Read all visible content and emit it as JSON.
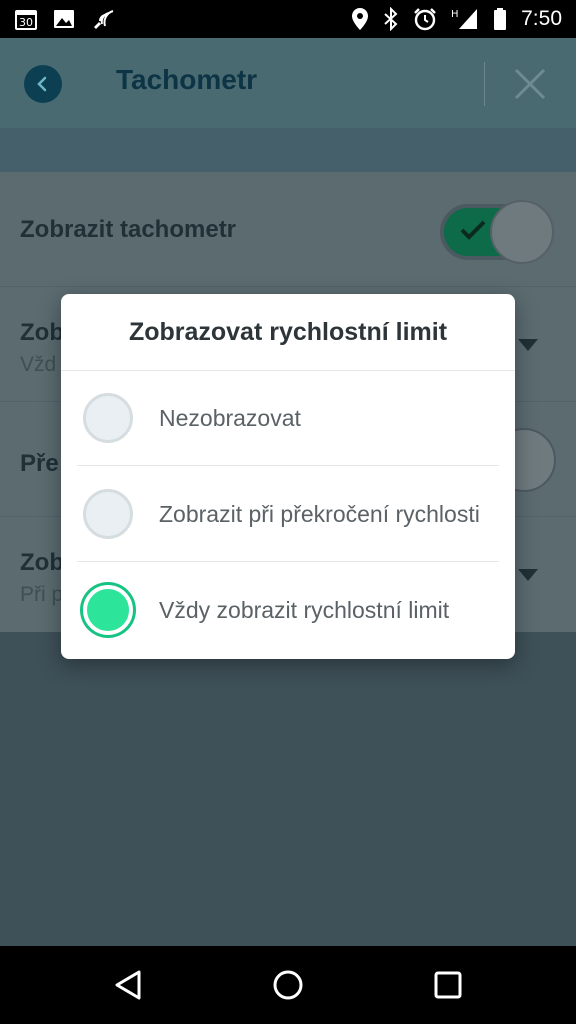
{
  "status_bar": {
    "calendar_day": "30",
    "network_type": "H",
    "time": "7:50",
    "icons_left": [
      "calendar-icon",
      "image-icon",
      "wifi-calling-icon"
    ],
    "icons_right": [
      "location-icon",
      "bluetooth-icon",
      "alarm-icon",
      "signal-icon",
      "battery-icon"
    ]
  },
  "app_bar": {
    "title": "Tachometr"
  },
  "settings": {
    "rows": [
      {
        "label": "Zobrazit tachometr",
        "sub": "",
        "control": "toggle-on"
      },
      {
        "label": "Zob",
        "sub": "Vžd",
        "control": "dropdown"
      },
      {
        "label": "Pře",
        "sub": "",
        "control": "toggle"
      },
      {
        "label": "Zob",
        "sub": "Při p",
        "control": "dropdown"
      }
    ]
  },
  "dialog": {
    "title": "Zobrazovat rychlostní limit",
    "options": [
      {
        "label": "Nezobrazovat",
        "checked": false
      },
      {
        "label": "Zobrazit při překročení rychlosti",
        "checked": false
      },
      {
        "label": "Vždy zobrazit rychlostní limit",
        "checked": true
      }
    ]
  },
  "colors": {
    "accent": "#2de49b",
    "app_bar_bg": "#4a6a72",
    "title_color": "#0d3445"
  }
}
